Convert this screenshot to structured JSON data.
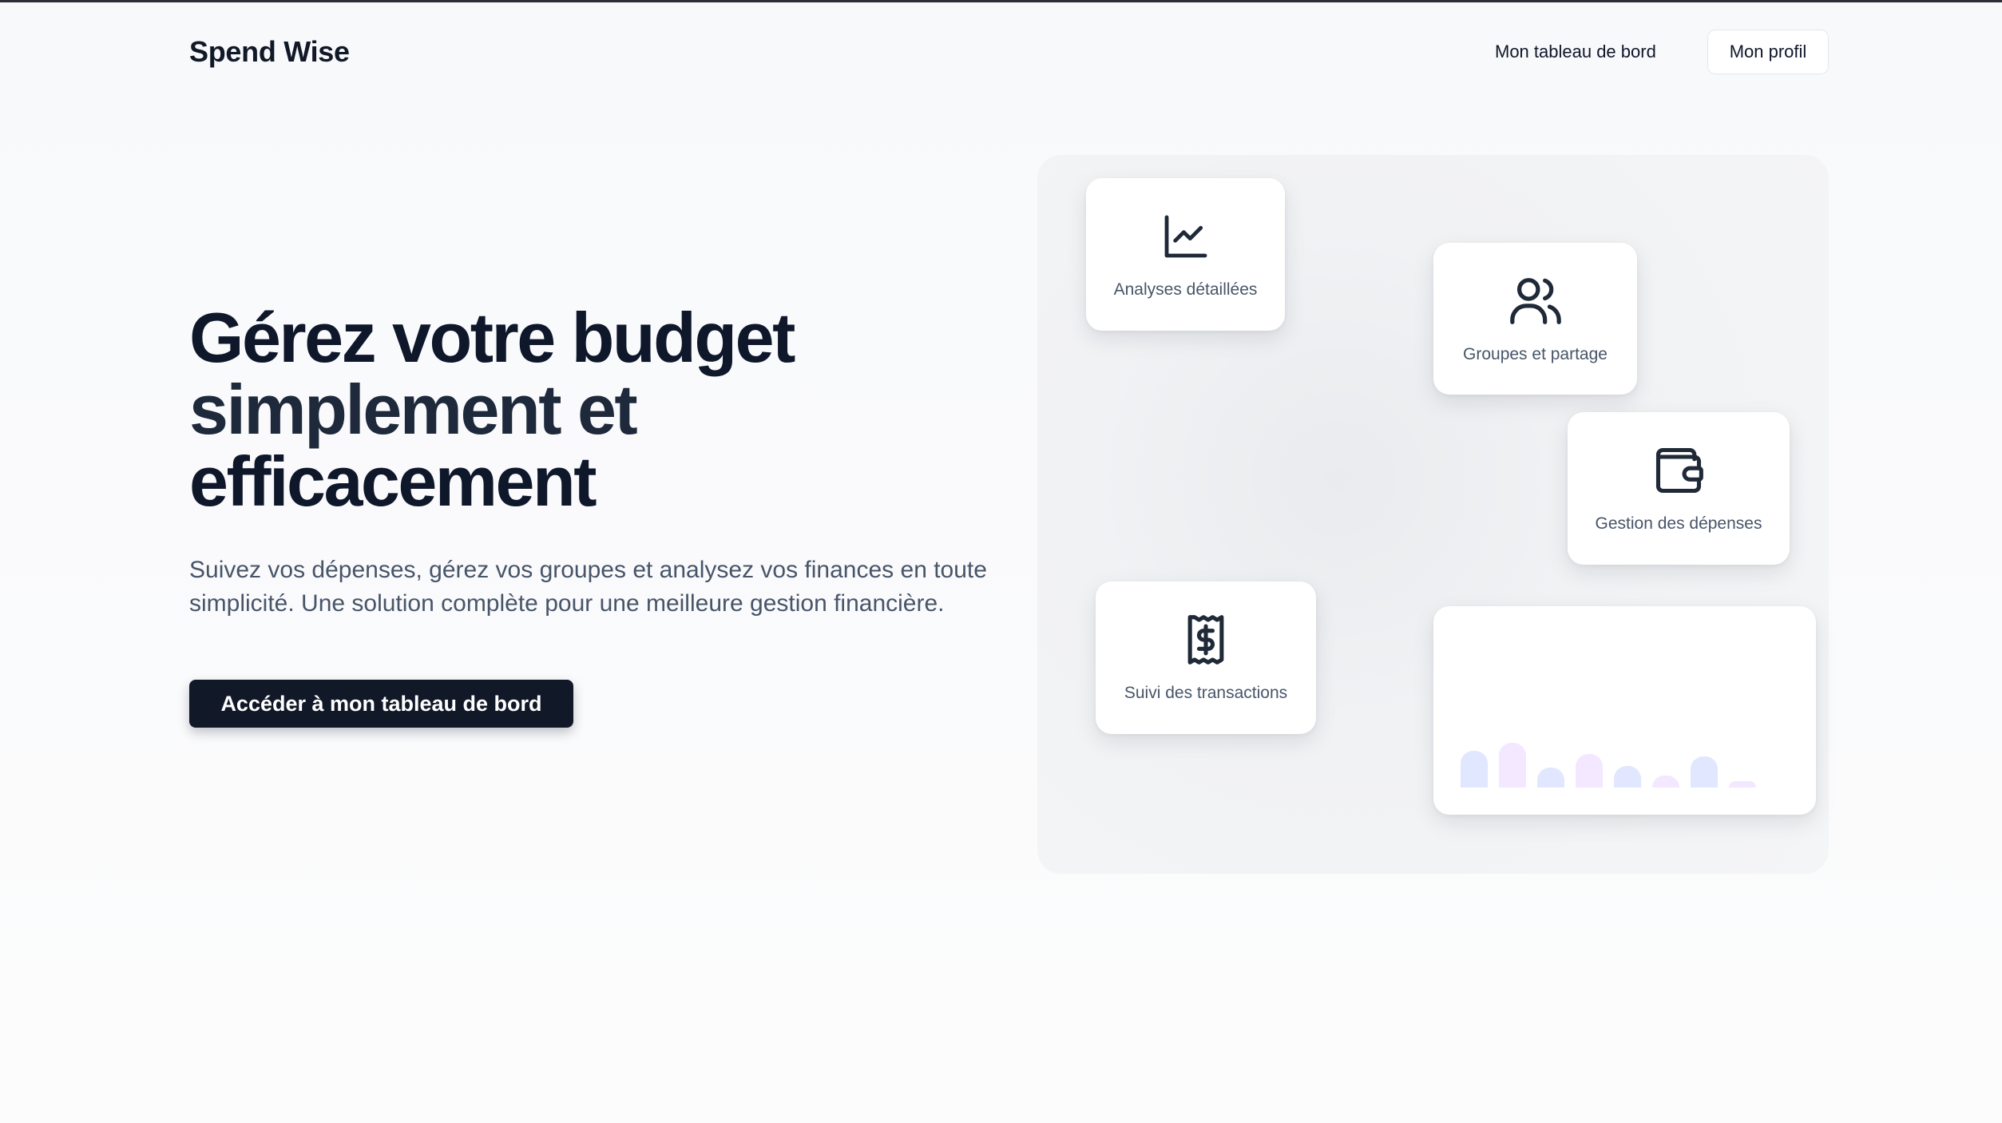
{
  "header": {
    "brand": "Spend Wise",
    "nav_dashboard": "Mon tableau de bord",
    "nav_profile": "Mon profil"
  },
  "hero": {
    "title_line1": "Gérez votre budget",
    "title_line2": "simplement et",
    "title_line3": "efficacement",
    "subtitle_line1": "Suivez vos dépenses, gérez vos groupes et analysez vos finances en toute",
    "subtitle_line2": "simplicité. Une solution complète pour une meilleure gestion financière.",
    "cta_label": "Accéder à mon tableau de bord"
  },
  "features": [
    {
      "label": "Analyses détaillées",
      "icon": "chart-line-icon"
    },
    {
      "label": "Groupes et partage",
      "icon": "users-icon"
    },
    {
      "label": "Gestion des dépenses",
      "icon": "wallet-icon"
    },
    {
      "label": "Suivi des transactions",
      "icon": "receipt-dollar-icon"
    }
  ],
  "preview_chart": {
    "bar_levels": [
      0.65,
      0.8,
      0.35,
      0.6,
      0.38,
      0.22,
      0.55,
      0.12
    ],
    "bar_colors": [
      "#e0e7ff",
      "#f3e8ff",
      "#e0e7ff",
      "#f3e8ff",
      "#e0e7ff",
      "#f3e8ff",
      "#e0e7ff",
      "#f3e8ff"
    ]
  },
  "colors": {
    "primary": "#111827",
    "text_muted": "#475569"
  }
}
